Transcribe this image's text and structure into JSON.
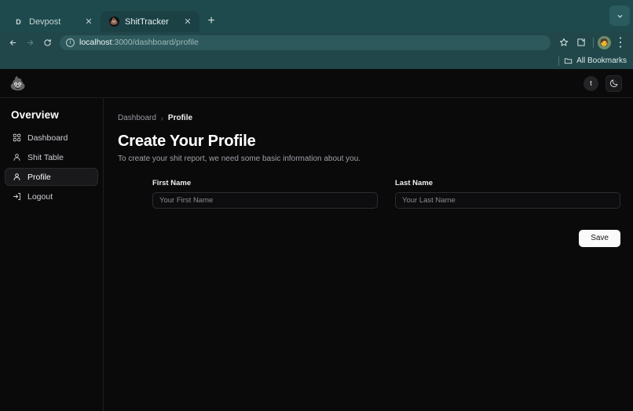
{
  "browser": {
    "tabs": [
      {
        "title": "Devpost",
        "favicon": "D",
        "active": false,
        "close_label": "✕"
      },
      {
        "title": "ShitTracker",
        "favicon": "💩",
        "active": true,
        "close_label": "✕"
      }
    ],
    "new_tab_label": "+",
    "tab_list_chevron": "⌵",
    "nav": {
      "back": "←",
      "forward": "→",
      "reload": "⟳"
    },
    "omnibox": {
      "site_info_icon": "ⓘ",
      "url_host": "localhost",
      "url_path": ":3000/dashboard/profile",
      "full_url": "localhost:3000/dashboard/profile"
    },
    "toolbar_icons": {
      "bookmark_star": "☆",
      "extensions": "puzzle",
      "menu": "⋮"
    },
    "profile_avatar": "🧑",
    "bookmarks_bar": {
      "folder_icon": "🗀",
      "label": "All Bookmarks"
    }
  },
  "app": {
    "header": {
      "logo": "💩",
      "user_initial": "t",
      "theme_toggle_icon": "🌙"
    },
    "sidebar": {
      "title": "Overview",
      "items": [
        {
          "label": "Dashboard",
          "icon": "grid-icon",
          "active": false
        },
        {
          "label": "Shit Table",
          "icon": "user-icon",
          "active": false
        },
        {
          "label": "Profile",
          "icon": "user-icon",
          "active": true
        },
        {
          "label": "Logout",
          "icon": "logout-icon",
          "active": false
        }
      ]
    },
    "breadcrumb": {
      "parent": "Dashboard",
      "separator": "›",
      "current": "Profile"
    },
    "page": {
      "title": "Create Your Profile",
      "subtitle": "To create your shit report, we need some basic information about you."
    },
    "form": {
      "fields": [
        {
          "label": "First Name",
          "placeholder": "Your First Name",
          "value": ""
        },
        {
          "label": "Last Name",
          "placeholder": "Your Last Name",
          "value": ""
        }
      ],
      "save_label": "Save"
    }
  },
  "colors": {
    "chrome_tabstrip": "#1f4a4d",
    "chrome_toolbar": "#21474a",
    "app_background": "#0a0a0b",
    "sidebar_active": "#19191c",
    "save_button": "#fafafa"
  }
}
